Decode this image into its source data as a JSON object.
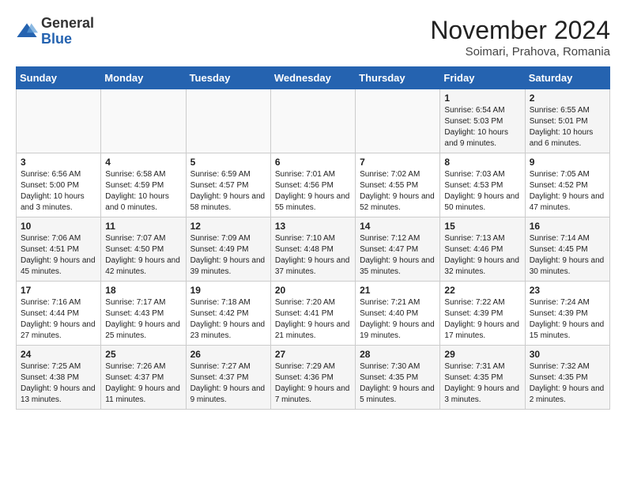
{
  "header": {
    "logo_general": "General",
    "logo_blue": "Blue",
    "month_title": "November 2024",
    "subtitle": "Soimari, Prahova, Romania"
  },
  "days_of_week": [
    "Sunday",
    "Monday",
    "Tuesday",
    "Wednesday",
    "Thursday",
    "Friday",
    "Saturday"
  ],
  "weeks": [
    [
      {
        "day": "",
        "info": ""
      },
      {
        "day": "",
        "info": ""
      },
      {
        "day": "",
        "info": ""
      },
      {
        "day": "",
        "info": ""
      },
      {
        "day": "",
        "info": ""
      },
      {
        "day": "1",
        "info": "Sunrise: 6:54 AM\nSunset: 5:03 PM\nDaylight: 10 hours and 9 minutes."
      },
      {
        "day": "2",
        "info": "Sunrise: 6:55 AM\nSunset: 5:01 PM\nDaylight: 10 hours and 6 minutes."
      }
    ],
    [
      {
        "day": "3",
        "info": "Sunrise: 6:56 AM\nSunset: 5:00 PM\nDaylight: 10 hours and 3 minutes."
      },
      {
        "day": "4",
        "info": "Sunrise: 6:58 AM\nSunset: 4:59 PM\nDaylight: 10 hours and 0 minutes."
      },
      {
        "day": "5",
        "info": "Sunrise: 6:59 AM\nSunset: 4:57 PM\nDaylight: 9 hours and 58 minutes."
      },
      {
        "day": "6",
        "info": "Sunrise: 7:01 AM\nSunset: 4:56 PM\nDaylight: 9 hours and 55 minutes."
      },
      {
        "day": "7",
        "info": "Sunrise: 7:02 AM\nSunset: 4:55 PM\nDaylight: 9 hours and 52 minutes."
      },
      {
        "day": "8",
        "info": "Sunrise: 7:03 AM\nSunset: 4:53 PM\nDaylight: 9 hours and 50 minutes."
      },
      {
        "day": "9",
        "info": "Sunrise: 7:05 AM\nSunset: 4:52 PM\nDaylight: 9 hours and 47 minutes."
      }
    ],
    [
      {
        "day": "10",
        "info": "Sunrise: 7:06 AM\nSunset: 4:51 PM\nDaylight: 9 hours and 45 minutes."
      },
      {
        "day": "11",
        "info": "Sunrise: 7:07 AM\nSunset: 4:50 PM\nDaylight: 9 hours and 42 minutes."
      },
      {
        "day": "12",
        "info": "Sunrise: 7:09 AM\nSunset: 4:49 PM\nDaylight: 9 hours and 39 minutes."
      },
      {
        "day": "13",
        "info": "Sunrise: 7:10 AM\nSunset: 4:48 PM\nDaylight: 9 hours and 37 minutes."
      },
      {
        "day": "14",
        "info": "Sunrise: 7:12 AM\nSunset: 4:47 PM\nDaylight: 9 hours and 35 minutes."
      },
      {
        "day": "15",
        "info": "Sunrise: 7:13 AM\nSunset: 4:46 PM\nDaylight: 9 hours and 32 minutes."
      },
      {
        "day": "16",
        "info": "Sunrise: 7:14 AM\nSunset: 4:45 PM\nDaylight: 9 hours and 30 minutes."
      }
    ],
    [
      {
        "day": "17",
        "info": "Sunrise: 7:16 AM\nSunset: 4:44 PM\nDaylight: 9 hours and 27 minutes."
      },
      {
        "day": "18",
        "info": "Sunrise: 7:17 AM\nSunset: 4:43 PM\nDaylight: 9 hours and 25 minutes."
      },
      {
        "day": "19",
        "info": "Sunrise: 7:18 AM\nSunset: 4:42 PM\nDaylight: 9 hours and 23 minutes."
      },
      {
        "day": "20",
        "info": "Sunrise: 7:20 AM\nSunset: 4:41 PM\nDaylight: 9 hours and 21 minutes."
      },
      {
        "day": "21",
        "info": "Sunrise: 7:21 AM\nSunset: 4:40 PM\nDaylight: 9 hours and 19 minutes."
      },
      {
        "day": "22",
        "info": "Sunrise: 7:22 AM\nSunset: 4:39 PM\nDaylight: 9 hours and 17 minutes."
      },
      {
        "day": "23",
        "info": "Sunrise: 7:24 AM\nSunset: 4:39 PM\nDaylight: 9 hours and 15 minutes."
      }
    ],
    [
      {
        "day": "24",
        "info": "Sunrise: 7:25 AM\nSunset: 4:38 PM\nDaylight: 9 hours and 13 minutes."
      },
      {
        "day": "25",
        "info": "Sunrise: 7:26 AM\nSunset: 4:37 PM\nDaylight: 9 hours and 11 minutes."
      },
      {
        "day": "26",
        "info": "Sunrise: 7:27 AM\nSunset: 4:37 PM\nDaylight: 9 hours and 9 minutes."
      },
      {
        "day": "27",
        "info": "Sunrise: 7:29 AM\nSunset: 4:36 PM\nDaylight: 9 hours and 7 minutes."
      },
      {
        "day": "28",
        "info": "Sunrise: 7:30 AM\nSunset: 4:35 PM\nDaylight: 9 hours and 5 minutes."
      },
      {
        "day": "29",
        "info": "Sunrise: 7:31 AM\nSunset: 4:35 PM\nDaylight: 9 hours and 3 minutes."
      },
      {
        "day": "30",
        "info": "Sunrise: 7:32 AM\nSunset: 4:35 PM\nDaylight: 9 hours and 2 minutes."
      }
    ]
  ]
}
